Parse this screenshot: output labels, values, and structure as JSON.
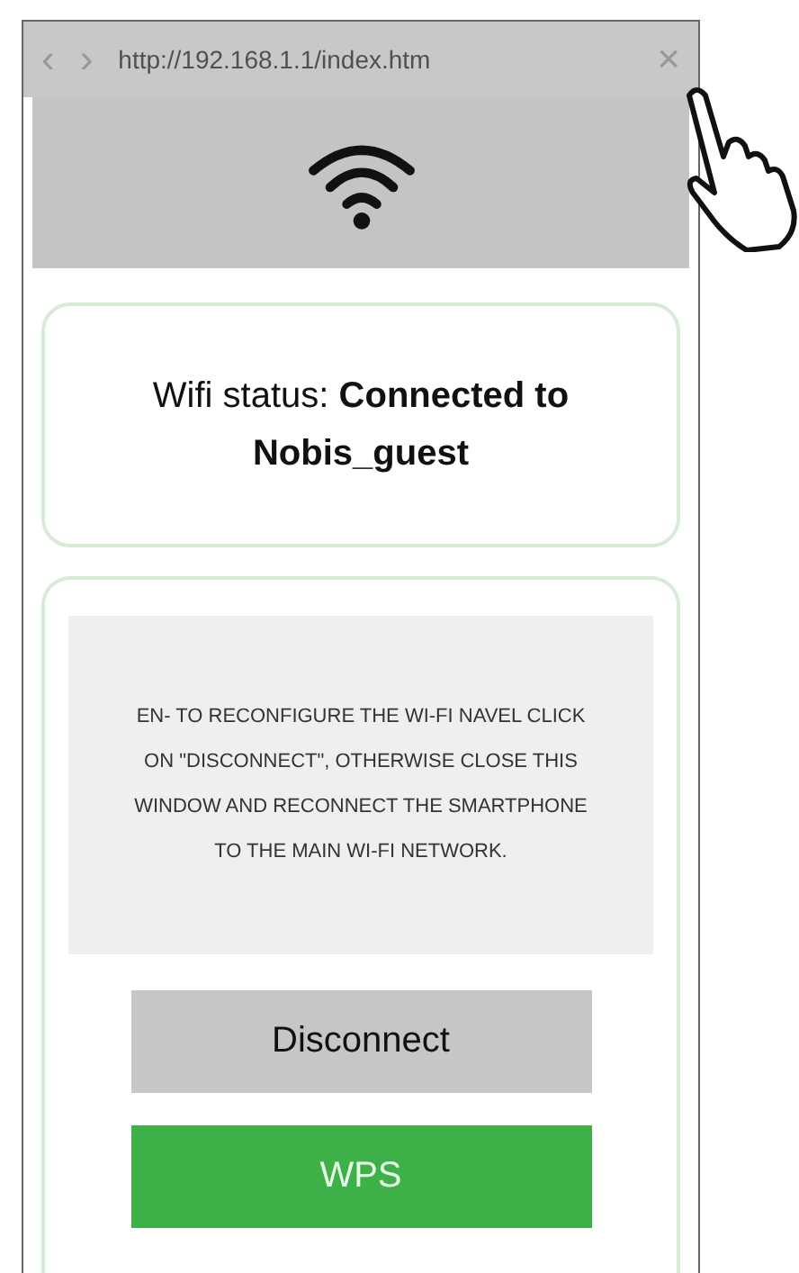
{
  "browser": {
    "back": "‹",
    "forward": "›",
    "url": "http://192.168.1.1/index.htm",
    "close": "×"
  },
  "status": {
    "text": "Wifi status: **Connected to Nobis_guest**"
  },
  "notice": "EN- TO RECONFIGURE THE WI-FI NAVEL CLICK ON \"DISCONNECT\", OTHERWISE CLOSE THIS WINDOW AND RECONNECT THE SMARTPHONE TO THE MAIN WI-FI NETWORK.",
  "buttons": [
    {
      "label": "Disconnect",
      "kind": "secondary"
    },
    {
      "label": "WPS",
      "kind": "primary"
    }
  ]
}
